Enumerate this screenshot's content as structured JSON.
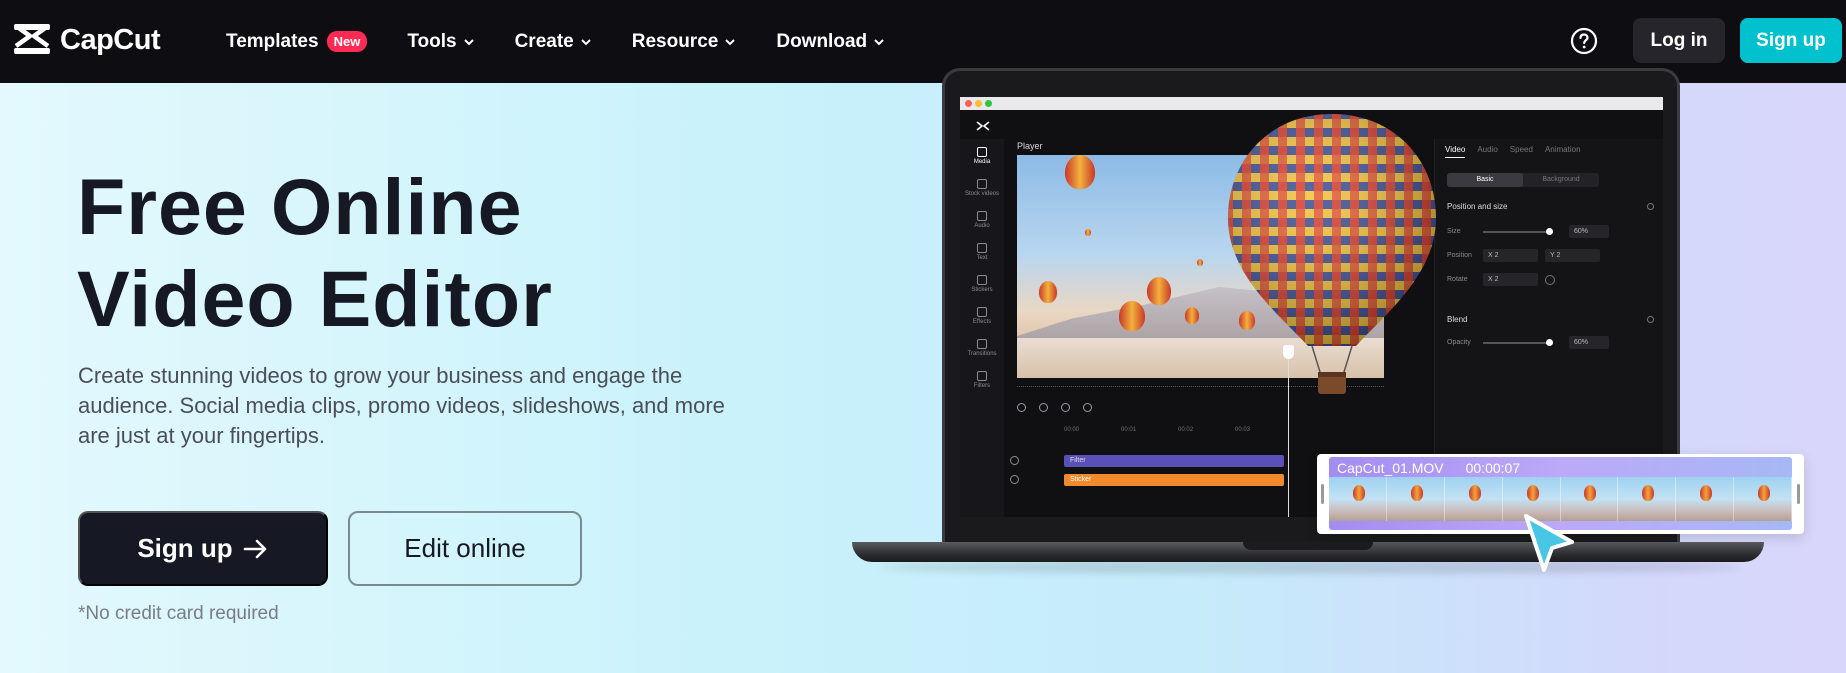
{
  "brand": {
    "name": "CapCut"
  },
  "nav": {
    "items": [
      {
        "label": "Templates",
        "badge": "New"
      },
      {
        "label": "Tools"
      },
      {
        "label": "Create"
      },
      {
        "label": "Resource"
      },
      {
        "label": "Download"
      }
    ],
    "login_label": "Log in",
    "signup_label": "Sign up",
    "help_icon": "help-circle-icon"
  },
  "hero": {
    "title_line1": "Free Online",
    "title_line2": "Video Editor",
    "description": "Create stunning videos to grow your business and engage the audience. Social media clips, promo videos, slideshows, and more are just at your fingertips.",
    "primary_cta": "Sign up",
    "secondary_cta": "Edit online",
    "note": "*No credit card required"
  },
  "editor": {
    "sidebar": [
      {
        "label": "Media",
        "active": true
      },
      {
        "label": "Stock videos"
      },
      {
        "label": "Audio"
      },
      {
        "label": "Text"
      },
      {
        "label": "Stickers"
      },
      {
        "label": "Effects"
      },
      {
        "label": "Transitions"
      },
      {
        "label": "Filters"
      }
    ],
    "player_label": "Player",
    "ruler": [
      "00:00",
      "00:01",
      "00:02",
      "00:03"
    ],
    "tracks": {
      "filter": "Filter",
      "sticker": "Sticker"
    },
    "panel": {
      "tabs": [
        "Video",
        "Audio",
        "Speed",
        "Animation"
      ],
      "segments": [
        "Basic",
        "Background"
      ],
      "position_size": "Position and size",
      "size_label": "Size",
      "size_value": "60%",
      "position_label": "Position",
      "pos_x": "2",
      "pos_y": "2",
      "x_prefix": "X",
      "y_prefix": "Y",
      "rotate_label": "Rotate",
      "rotate_value": "2",
      "blend": "Blend",
      "opacity_label": "Opacity",
      "opacity_value": "60%"
    },
    "clip": {
      "name": "CapCut_01.MOV",
      "duration": "00:00:07"
    }
  },
  "colors": {
    "nav_bg": "#0d0d12",
    "accent": "#00c1cd",
    "badge": "#fe2c55",
    "dark_button": "#161823"
  }
}
